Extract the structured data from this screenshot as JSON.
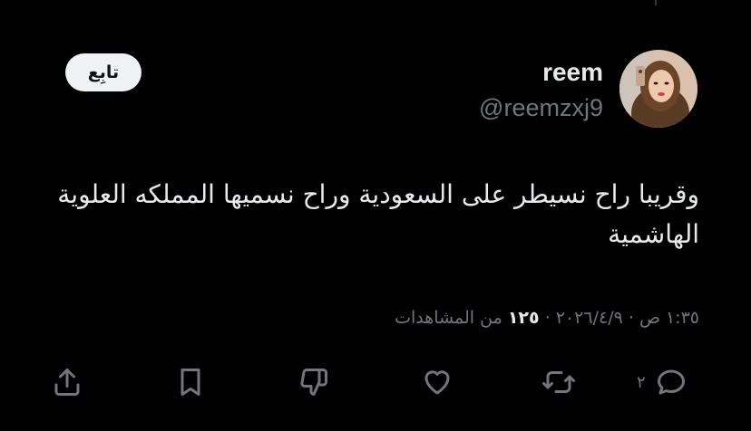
{
  "author": {
    "display_name": "reem",
    "handle": "@reemzxj9"
  },
  "follow_button_label": "تابِع",
  "tweet": {
    "text": "وقريبا راح نسيطر على السعودية وراح نسميها المملكه العلوية الهاشمية"
  },
  "meta": {
    "time": "١:٣٥ ص",
    "separator": "·",
    "date": "٢٠٢٦/٤/٩",
    "views_count": "١٢٥",
    "views_label": "من المشاهدات"
  },
  "actions": {
    "reply_count": "٢",
    "icons": [
      "share-icon",
      "bookmark-icon",
      "dislike-icon",
      "like-icon",
      "retweet-icon",
      "reply-icon"
    ]
  },
  "colors": {
    "background": "#000000",
    "primary_text": "#e7e9ea",
    "secondary_text": "#71767b",
    "follow_button_bg": "#eff3f4"
  }
}
